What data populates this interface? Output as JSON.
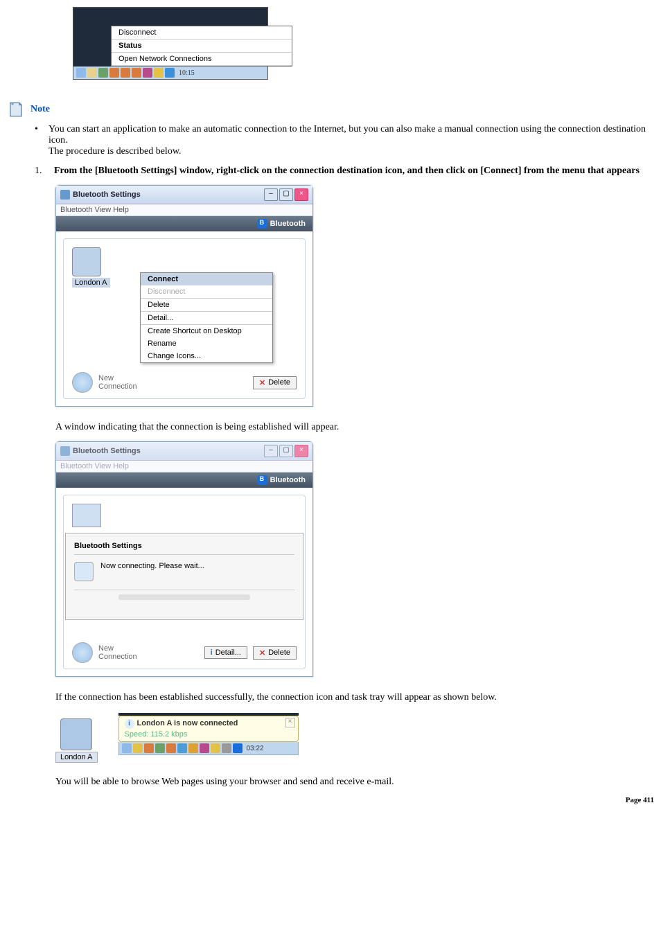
{
  "top_menu": {
    "items": [
      "Disconnect",
      "Status",
      "Open Network Connections"
    ],
    "clock": "10:15"
  },
  "note": {
    "label": "Note",
    "bullet_text_1": "You can start an application to make an automatic connection to the Internet, but you can also make a manual connection using the connection destination icon.",
    "bullet_text_2": "The procedure is described below."
  },
  "step1": {
    "num": "1.",
    "text": "From the [Bluetooth Settings] window, right-click on the connection destination icon, and then click on [Connect] from the menu that appears"
  },
  "win1": {
    "title": "Bluetooth Settings",
    "menus": "Bluetooth   View   Help",
    "brand": "Bluetooth",
    "device": "London A",
    "ctx": [
      "Connect",
      "Disconnect",
      "Delete",
      "Detail...",
      "Create Shortcut on Desktop",
      "Rename",
      "Change Icons..."
    ],
    "new_conn": "New\nConnection",
    "delete_btn": "Delete"
  },
  "mid_text": "A window indicating that the connection is being established will appear.",
  "win2": {
    "title": "Bluetooth Settings",
    "menus": "Bluetooth   View   Help",
    "brand": "Bluetooth",
    "dlg_title": "Bluetooth Settings",
    "dlg_text": "Now connecting. Please wait...",
    "new_conn": "New\nConnection",
    "detail_btn": "Detail...",
    "delete_btn": "Delete"
  },
  "after_text": "If the connection has been established successfully, the connection icon and task tray will appear as shown below.",
  "success": {
    "icon_label": "London A",
    "balloon_title": "London A is now connected",
    "balloon_speed": "Speed: 115.2 kbps",
    "clock": "03:22"
  },
  "final_text": "You will be able to browse Web pages using your browser and send and receive e-mail.",
  "page_label": "Page 411"
}
